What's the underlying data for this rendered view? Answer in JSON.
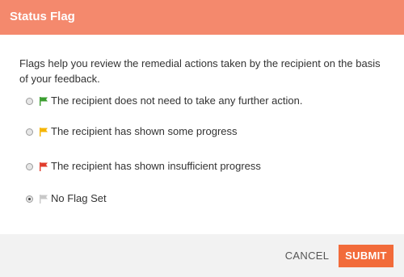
{
  "dialog": {
    "title": "Status Flag",
    "description": "Flags help you review the remedial actions taken by the recipient on the basis of your feedback.",
    "options": [
      {
        "label": "The recipient does not need to take any further action.",
        "flag_color": "#3a9d2f",
        "icon": "green-flag-icon",
        "selected": false
      },
      {
        "label": "The recipient has shown some progress",
        "flag_color": "#f5b400",
        "icon": "yellow-flag-icon",
        "selected": false
      },
      {
        "label": "The recipient has shown insufficient progress",
        "flag_color": "#e03b2b",
        "icon": "red-flag-icon",
        "selected": false
      },
      {
        "label": "No Flag Set",
        "flag_color": "#c8c8c8",
        "icon": "gray-flag-icon",
        "selected": true
      }
    ],
    "cancel_label": "CANCEL",
    "submit_label": "SUBMIT"
  },
  "colors": {
    "header": "#f4896d",
    "submit": "#f26b3a",
    "footer": "#f2f2f2"
  }
}
